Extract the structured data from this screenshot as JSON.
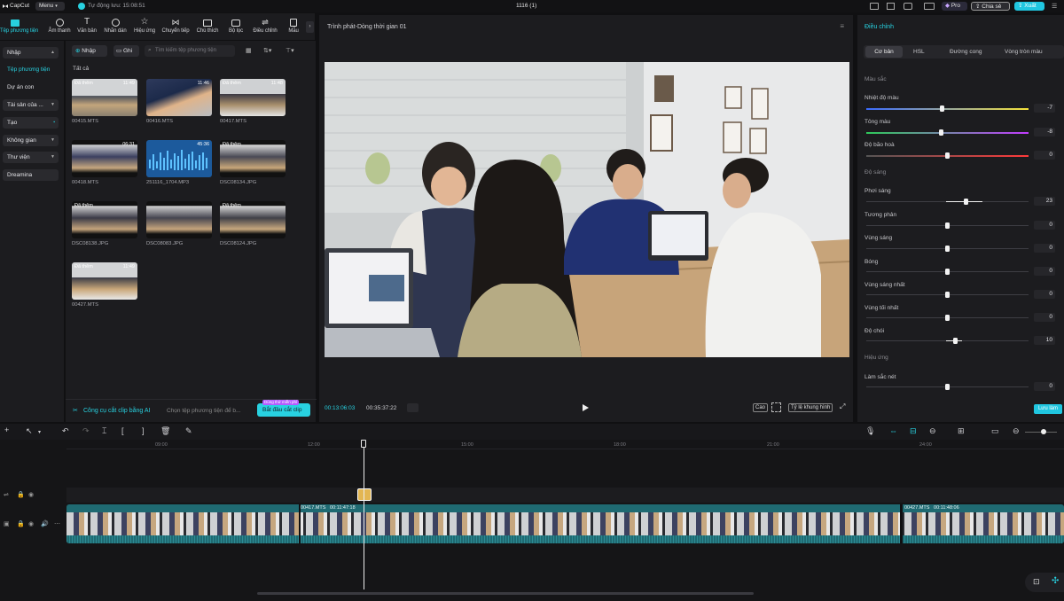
{
  "topbar": {
    "app_name": "CapCut",
    "menu_label": "Menu",
    "autosave_label": "Tự động lưu: 15:08:51",
    "project_title": "1116 (1)",
    "pro_label": "Pro",
    "share_label": "Chia sẻ",
    "export_label": "Xuất"
  },
  "tools": [
    {
      "label": "Tệp phương tiện",
      "icon": "media-icon"
    },
    {
      "label": "Âm thanh",
      "icon": "audio-icon"
    },
    {
      "label": "Văn bản",
      "icon": "text-icon"
    },
    {
      "label": "Nhãn dán",
      "icon": "sticker-icon"
    },
    {
      "label": "Hiệu ứng",
      "icon": "effects-icon"
    },
    {
      "label": "Chuyển tiếp",
      "icon": "transition-icon"
    },
    {
      "label": "Chú thích",
      "icon": "captions-icon"
    },
    {
      "label": "Bộ lọc",
      "icon": "filter-icon"
    },
    {
      "label": "Điều chỉnh",
      "icon": "adjust-icon"
    },
    {
      "label": "Mẫu",
      "icon": "template-icon"
    }
  ],
  "leftnav": {
    "import": "Nhập",
    "media_files": "Tệp phương tiện",
    "project": "Dự án con",
    "assets": "Tài sản của ...",
    "create": "Tạo",
    "space": "Không gian",
    "library": "Thư viện",
    "dreamina": "Dreamina"
  },
  "media": {
    "import_button": "Nhập",
    "record_button": "Ghi",
    "search_placeholder": "Tìm kiếm tệp phương tiện",
    "filter_all": "Tất cả",
    "items": [
      {
        "name": "00415.MTS",
        "badge": "Đã thêm",
        "duration": "11:49"
      },
      {
        "name": "00416.MTS",
        "badge": "",
        "duration": "11:46"
      },
      {
        "name": "00417.MTS",
        "badge": "Đã thêm",
        "duration": "11:48"
      },
      {
        "name": "00418.MTS",
        "badge": "",
        "duration": "06:31"
      },
      {
        "name": "251116_1704.MP3",
        "badge": "",
        "duration": "45:36"
      },
      {
        "name": "DSC08134.JPG",
        "badge": "Đã thêm",
        "duration": ""
      },
      {
        "name": "DSC08138.JPG",
        "badge": "Đã thêm",
        "duration": ""
      },
      {
        "name": "DSC08083.JPG",
        "badge": "",
        "duration": ""
      },
      {
        "name": "DSC08124.JPG",
        "badge": "Đã thêm",
        "duration": ""
      },
      {
        "name": "00427.MTS",
        "badge": "Đã thêm",
        "duration": "11:49"
      }
    ],
    "ai_tool_label": "Công cụ cắt clip bằng AI",
    "ai_tool_hint": "Chọn tệp phương tiện để b...",
    "ai_tool_tag": "Dùng thử miễn phí",
    "ai_tool_button": "Bắt đầu cắt clip"
  },
  "player": {
    "title": "Trình phát-Dòng thời gian 01",
    "current_time": "00:13:06:03",
    "total_time": "00:35:37:22",
    "quality": "Cao",
    "ratio": "Tỷ lệ khung hình"
  },
  "right": {
    "title": "Điều chỉnh",
    "tabs": [
      "Cơ bản",
      "HSL",
      "Đường cong",
      "Vòng tròn màu"
    ],
    "sections": {
      "color": "Màu sắc",
      "light": "Độ sáng",
      "effect": "Hiệu ứng"
    },
    "sliders": [
      {
        "label": "Nhiệt độ màu",
        "value": "-7",
        "level": -7
      },
      {
        "label": "Tông màu",
        "value": "-8",
        "level": -8
      },
      {
        "label": "Độ bão hoà",
        "value": "0",
        "level": 0
      },
      {
        "label": "Phơi sáng",
        "value": "23",
        "level": 23
      },
      {
        "label": "Tương phản",
        "value": "0",
        "level": 0
      },
      {
        "label": "Vùng sáng",
        "value": "0",
        "level": 0
      },
      {
        "label": "Bóng",
        "value": "0",
        "level": 0
      },
      {
        "label": "Vùng sáng nhất",
        "value": "0",
        "level": 0
      },
      {
        "label": "Vùng tối nhất",
        "value": "0",
        "level": 0
      },
      {
        "label": "Độ chói",
        "value": "10",
        "level": 10
      },
      {
        "label": "Làm sắc nét",
        "value": "0",
        "level": 0
      }
    ],
    "save_label": "Lưu làm"
  },
  "timeline": {
    "ruler": [
      "09:00",
      "12:00",
      "15:00",
      "18:00",
      "21:00",
      "24:00"
    ],
    "clip1_label": "00417.MTS   00:11:47:18",
    "clip2_label": "00427.MTS   00:11:48:06"
  },
  "colors": {
    "accent": "#28d1e0",
    "clip": "#1f6a72",
    "export": "#20c6e0"
  }
}
